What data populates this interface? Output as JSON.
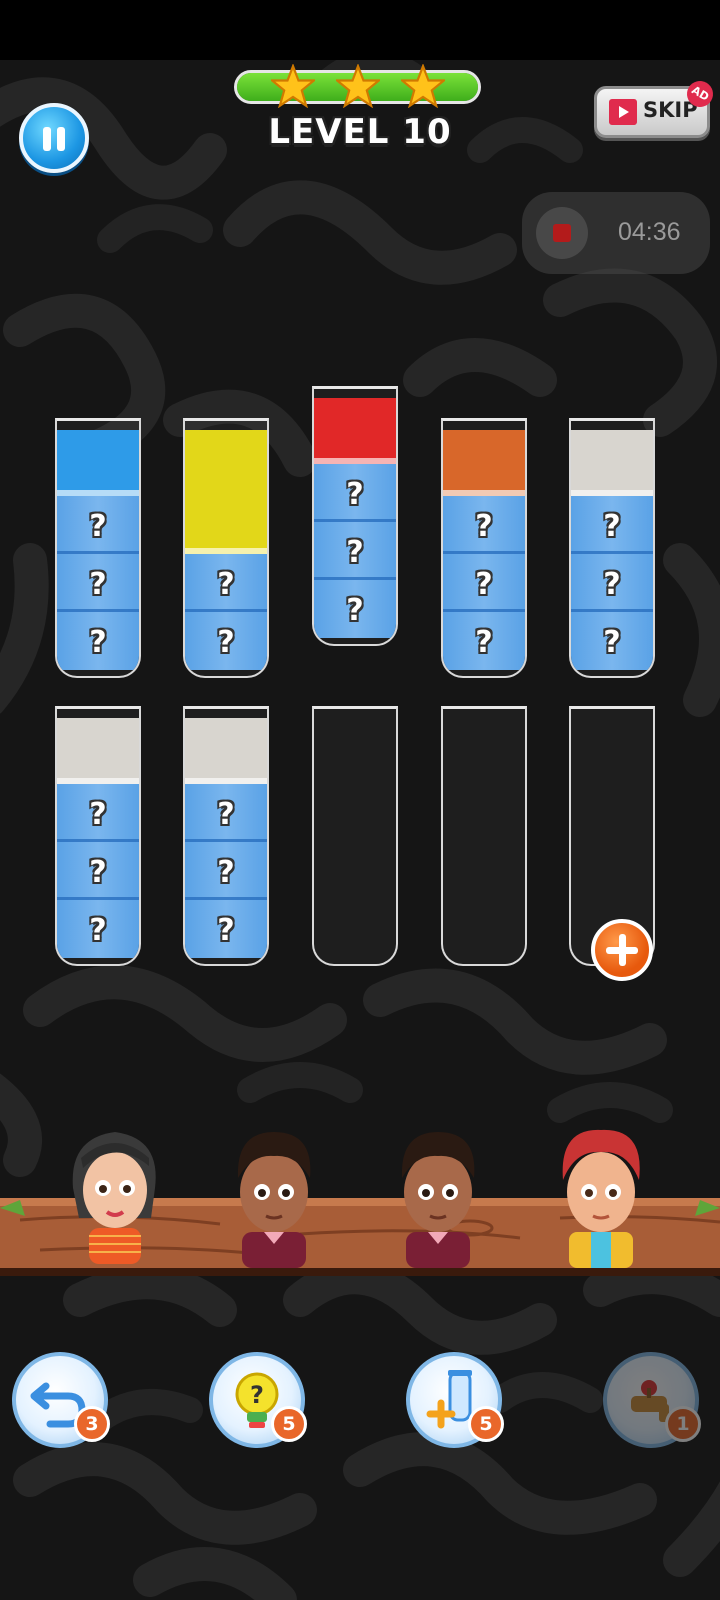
{
  "header": {
    "level_label": "LEVEL 10",
    "progress_fraction": 1.0,
    "stars_earned": 3,
    "stars_total": 3,
    "skip_label": "SKIP",
    "skip_badge": "AD",
    "recording_time": "04:36"
  },
  "colors": {
    "blue": "#2e9be8",
    "yellow": "#e2d719",
    "red": "#e12828",
    "orange": "#d8672a",
    "white": "#d8d5cf",
    "hidden": "#7ab6ee",
    "accent_orange": "#e9672a",
    "progress_green": "#5ec92a"
  },
  "board": {
    "capacity": 4,
    "hidden_marker": "?",
    "tubes": [
      {
        "top": [
          "blue"
        ],
        "hidden": 3
      },
      {
        "top": [
          "yellow",
          "yellow"
        ],
        "hidden": 2
      },
      {
        "top": [
          "red"
        ],
        "hidden": 3
      },
      {
        "top": [
          "orange"
        ],
        "hidden": 3
      },
      {
        "top": [
          "white"
        ],
        "hidden": 3
      },
      {
        "top": [
          "white"
        ],
        "hidden": 3
      },
      {
        "top": [
          "white"
        ],
        "hidden": 3
      },
      {
        "top": [],
        "hidden": 0
      },
      {
        "top": [],
        "hidden": 0
      },
      {
        "top": [],
        "hidden": 0,
        "locked_add": true
      }
    ]
  },
  "characters": [
    "girl-dark-hair",
    "boy-maroon-sweater",
    "boy-maroon-sweater",
    "boy-red-hair"
  ],
  "tools": [
    {
      "name": "undo",
      "icon": "undo-arrow-icon",
      "count": "3",
      "enabled": true
    },
    {
      "name": "hint",
      "icon": "lightbulb-question-icon",
      "count": "5",
      "enabled": true
    },
    {
      "name": "add-tube",
      "icon": "add-tube-icon",
      "count": "5",
      "enabled": true
    },
    {
      "name": "faucet",
      "icon": "faucet-icon",
      "count": "1",
      "enabled": false
    }
  ]
}
